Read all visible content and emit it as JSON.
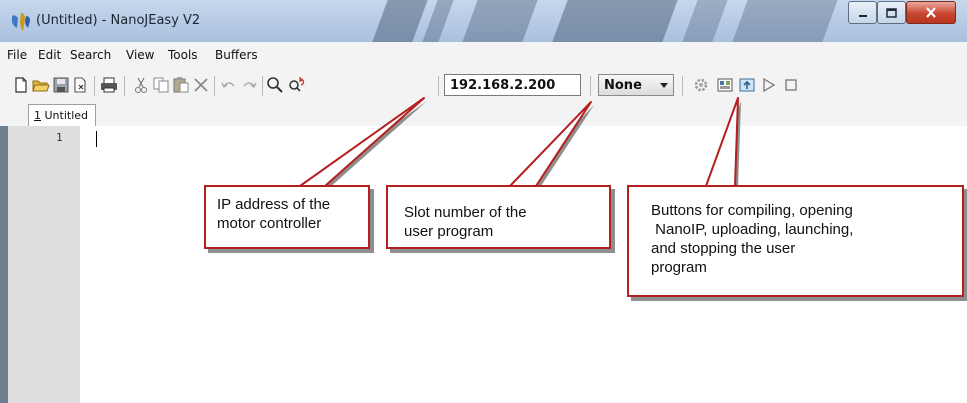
{
  "window": {
    "title": "(Untitled) - NanoJEasy V2",
    "accent_color": "#b41f1f"
  },
  "caption_buttons": [
    "minimize",
    "maximize",
    "close"
  ],
  "menubar": {
    "items": [
      "File",
      "Edit",
      "Search",
      "View",
      "Tools",
      "Buffers"
    ]
  },
  "toolbar": {
    "icons": [
      "new-file-icon",
      "open-folder-icon",
      "save-icon",
      "close-file-icon",
      "print-icon",
      "cut-icon",
      "copy-icon",
      "paste-icon",
      "delete-icon",
      "undo-icon",
      "redo-icon",
      "find-icon",
      "find-replace-icon",
      "compile-icon",
      "open-nanoip-icon",
      "upload-icon",
      "launch-icon",
      "stop-icon"
    ],
    "ip_address": "192.168.2.200",
    "slot_selected": "None"
  },
  "tabs": [
    {
      "number": "1",
      "label": "Untitled"
    }
  ],
  "editor": {
    "line_numbers": [
      "1"
    ],
    "content": ""
  },
  "callouts": [
    {
      "lines": [
        "IP address of the",
        "motor controller"
      ]
    },
    {
      "lines": [
        "Slot number of the",
        "user program"
      ]
    },
    {
      "lines": [
        "Buttons for compiling, opening",
        " NanoIP, uploading, launching,",
        "and stopping the user",
        "program"
      ]
    }
  ]
}
